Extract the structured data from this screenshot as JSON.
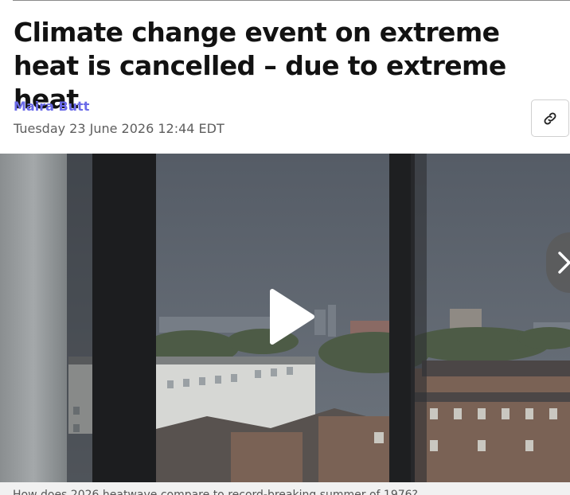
{
  "article": {
    "headline": "Climate change event on extreme heat is cancelled – due to extreme heat",
    "author": "Maira Butt",
    "dateline": "Tuesday 23 June 2026 12:44 EDT",
    "caption": "How does 2026 heatwave compare to record-breaking summer of 1976?"
  },
  "icons": {
    "share": "link-icon",
    "play": "play-icon",
    "next": "chevron-right-icon"
  },
  "colors": {
    "author_accent": "#6a6ae8",
    "headline": "#121212",
    "dateline": "#5e5e5e"
  }
}
